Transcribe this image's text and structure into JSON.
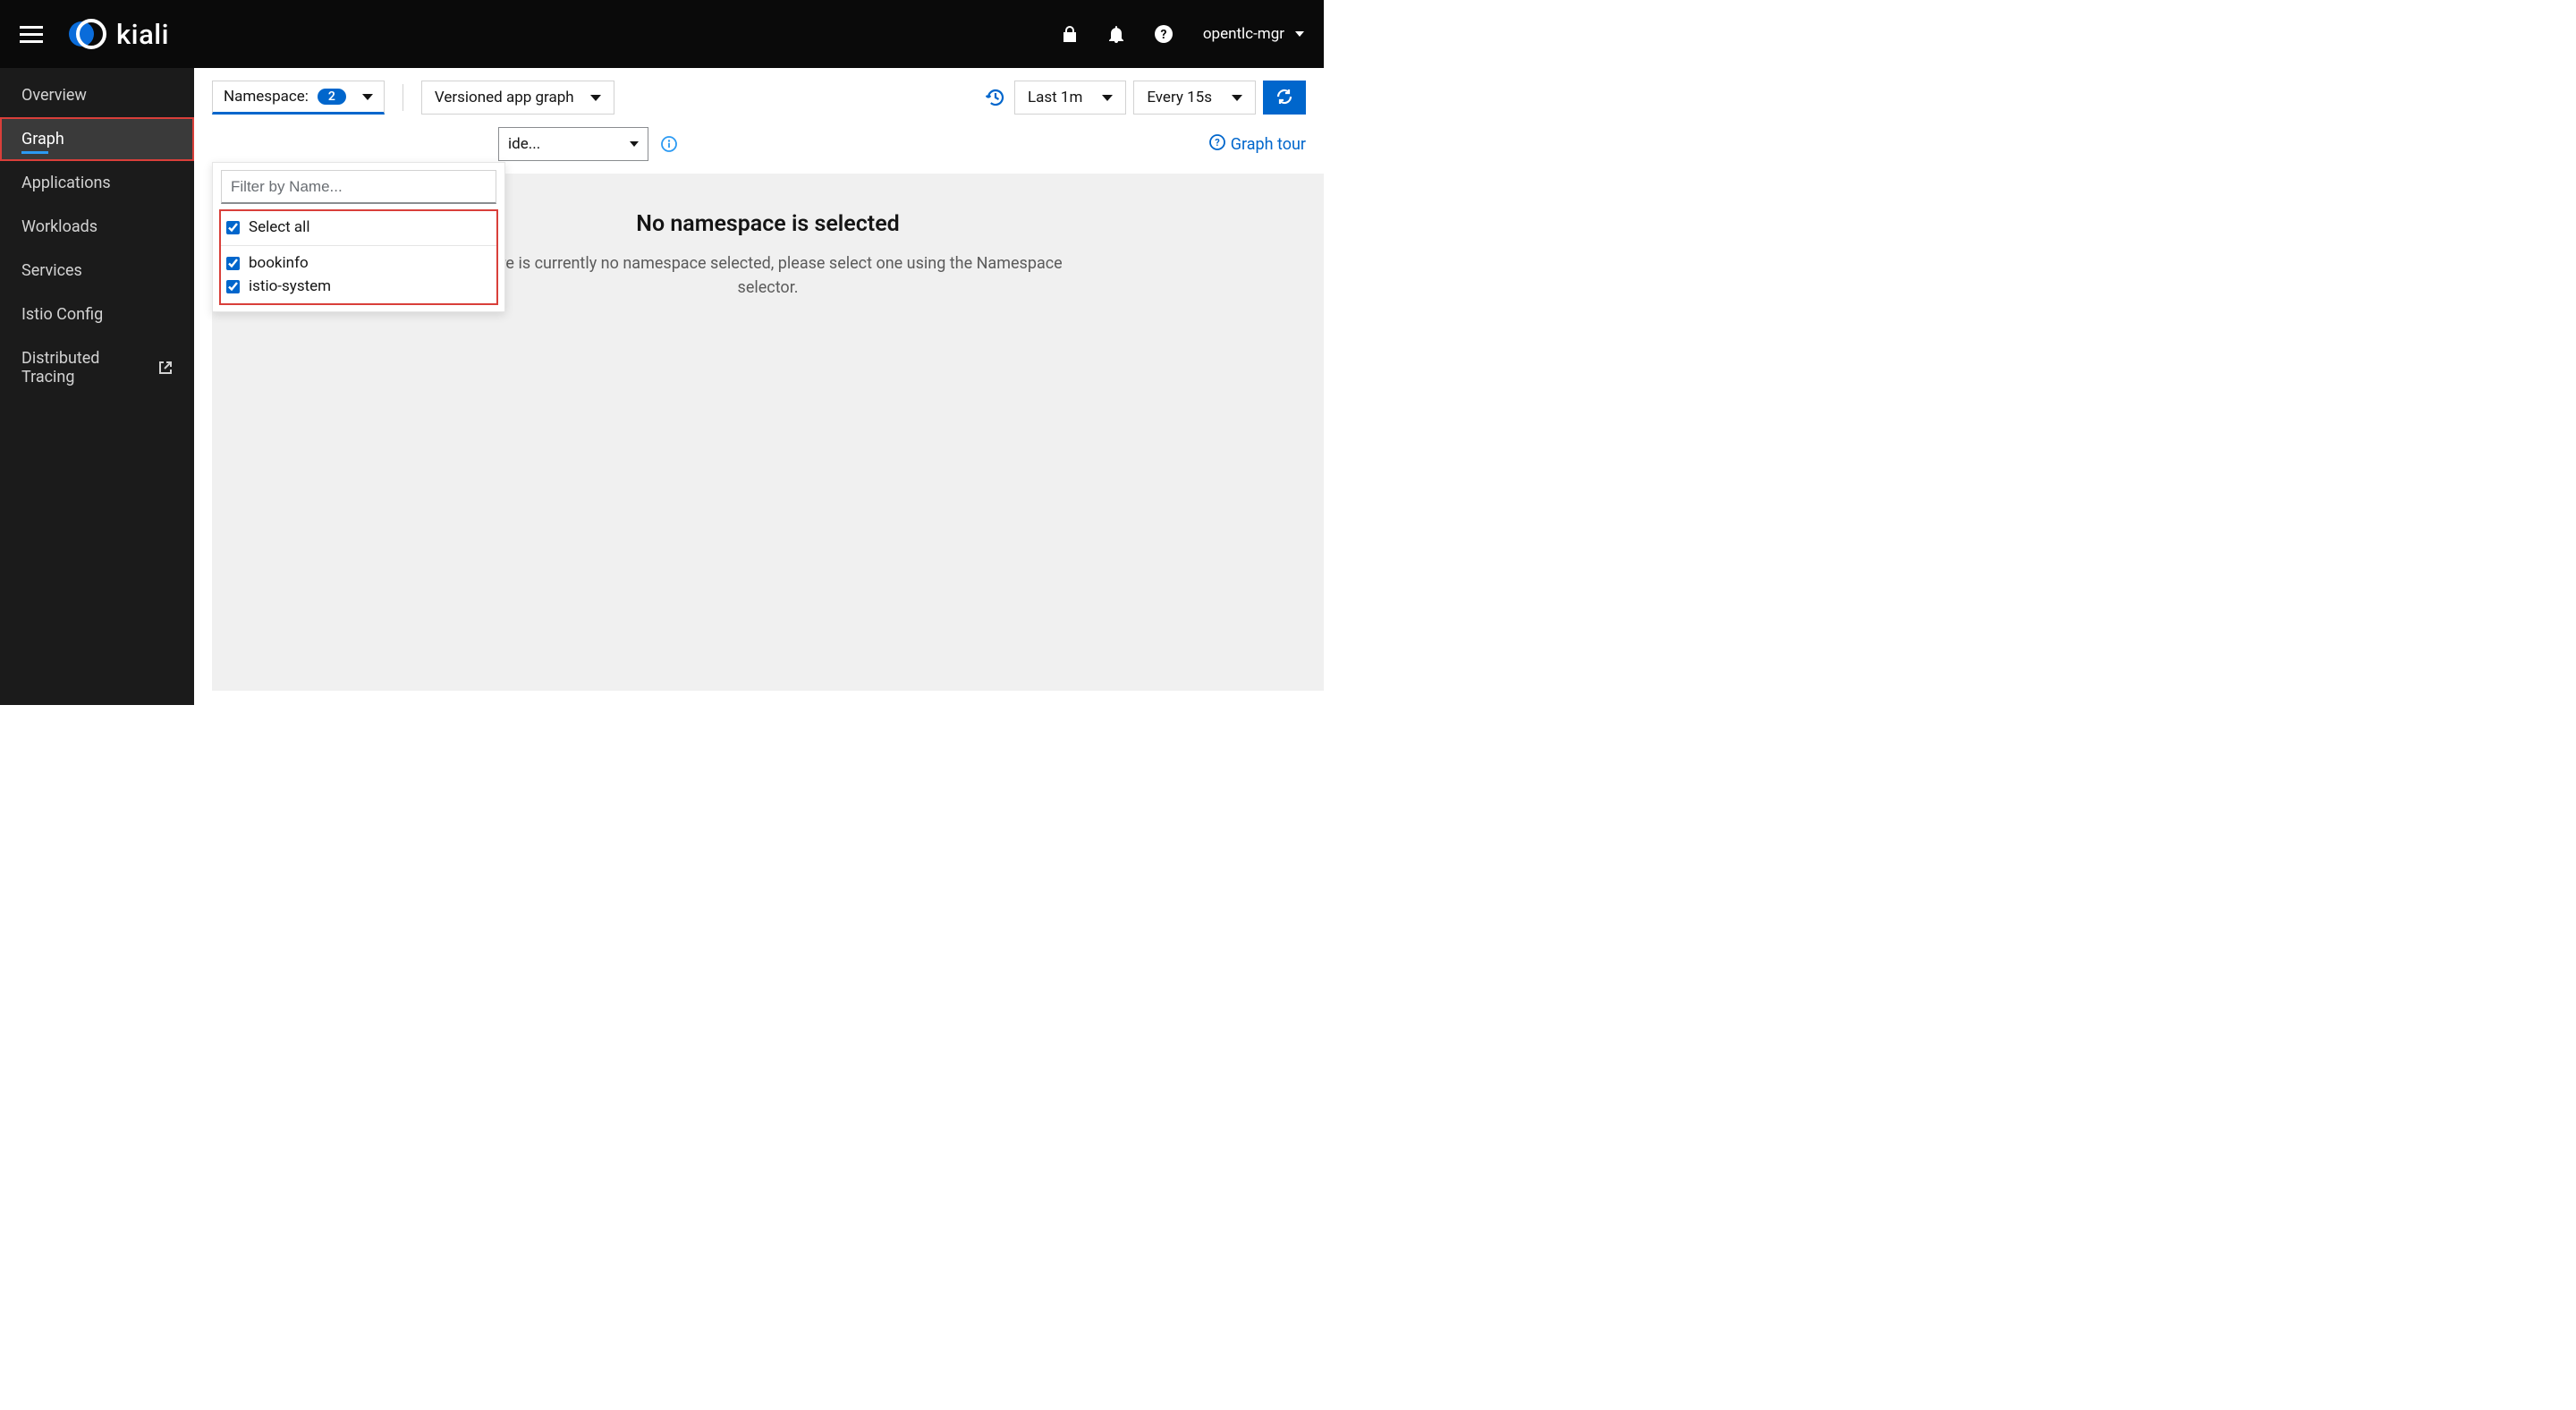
{
  "header": {
    "brand_text": "kiali",
    "user_label": "opentlc-mgr"
  },
  "sidebar": {
    "items": [
      {
        "label": "Overview"
      },
      {
        "label": "Graph"
      },
      {
        "label": "Applications"
      },
      {
        "label": "Workloads"
      },
      {
        "label": "Services"
      },
      {
        "label": "Istio Config"
      },
      {
        "label": "Distributed Tracing"
      }
    ]
  },
  "toolbar": {
    "namespace_label": "Namespace:",
    "namespace_count": "2",
    "graph_type": "Versioned app graph",
    "time_range": "Last 1m",
    "refresh_interval": "Every 15s"
  },
  "toolbar2": {
    "hide_label": "ide...",
    "graph_tour": "Graph tour"
  },
  "ns_dropdown": {
    "filter_placeholder": "Filter by Name...",
    "select_all_label": "Select all",
    "items": [
      {
        "label": "bookinfo",
        "checked": true
      },
      {
        "label": "istio-system",
        "checked": true
      }
    ]
  },
  "empty": {
    "title": "No namespace is selected",
    "desc": "There is currently no namespace selected, please select one using the Namespace selector."
  }
}
